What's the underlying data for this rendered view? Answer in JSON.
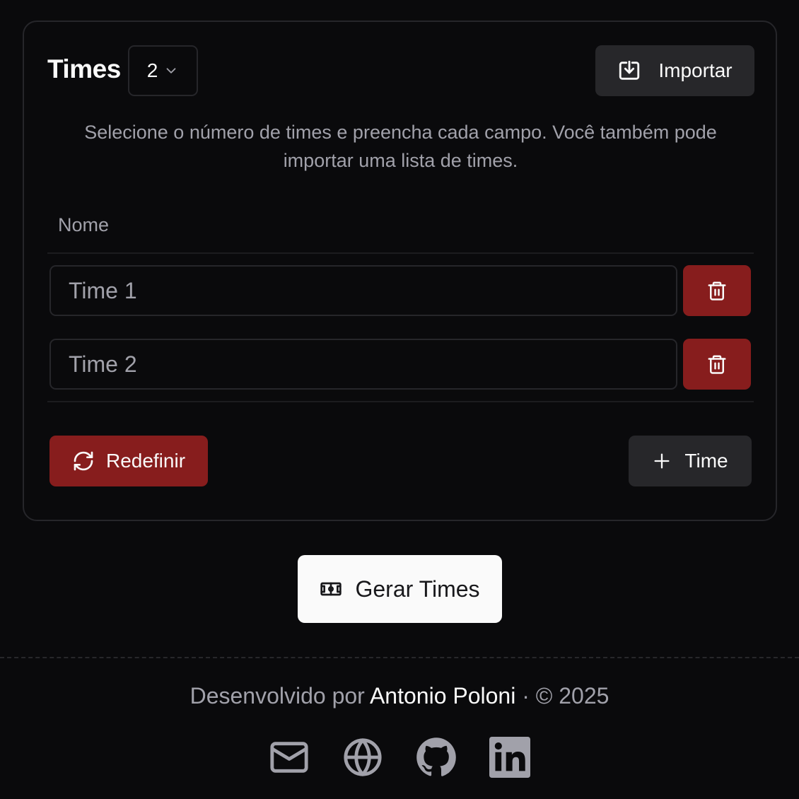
{
  "card": {
    "title": "Times",
    "team_count": "2",
    "import_label": "Importar",
    "description": "Selecione o número de times e preencha cada campo. Você também pode importar uma lista de times.",
    "column_header": "Nome",
    "teams": [
      {
        "value": "",
        "placeholder": "Time 1"
      },
      {
        "value": "",
        "placeholder": "Time 2"
      }
    ],
    "reset_label": "Redefinir",
    "add_label": "Time"
  },
  "generate_label": "Gerar Times",
  "footer": {
    "prefix": "Desenvolvido por ",
    "author": "Antonio Poloni",
    "suffix": " · © 2025",
    "links": [
      "mail-icon",
      "globe-icon",
      "github-icon",
      "linkedin-icon"
    ]
  },
  "colors": {
    "background": "#0a0a0c",
    "danger": "#871d1d",
    "secondary": "#27272a",
    "primary_button": "#fafafa",
    "muted_text": "#a1a1aa",
    "border": "#26262a"
  }
}
